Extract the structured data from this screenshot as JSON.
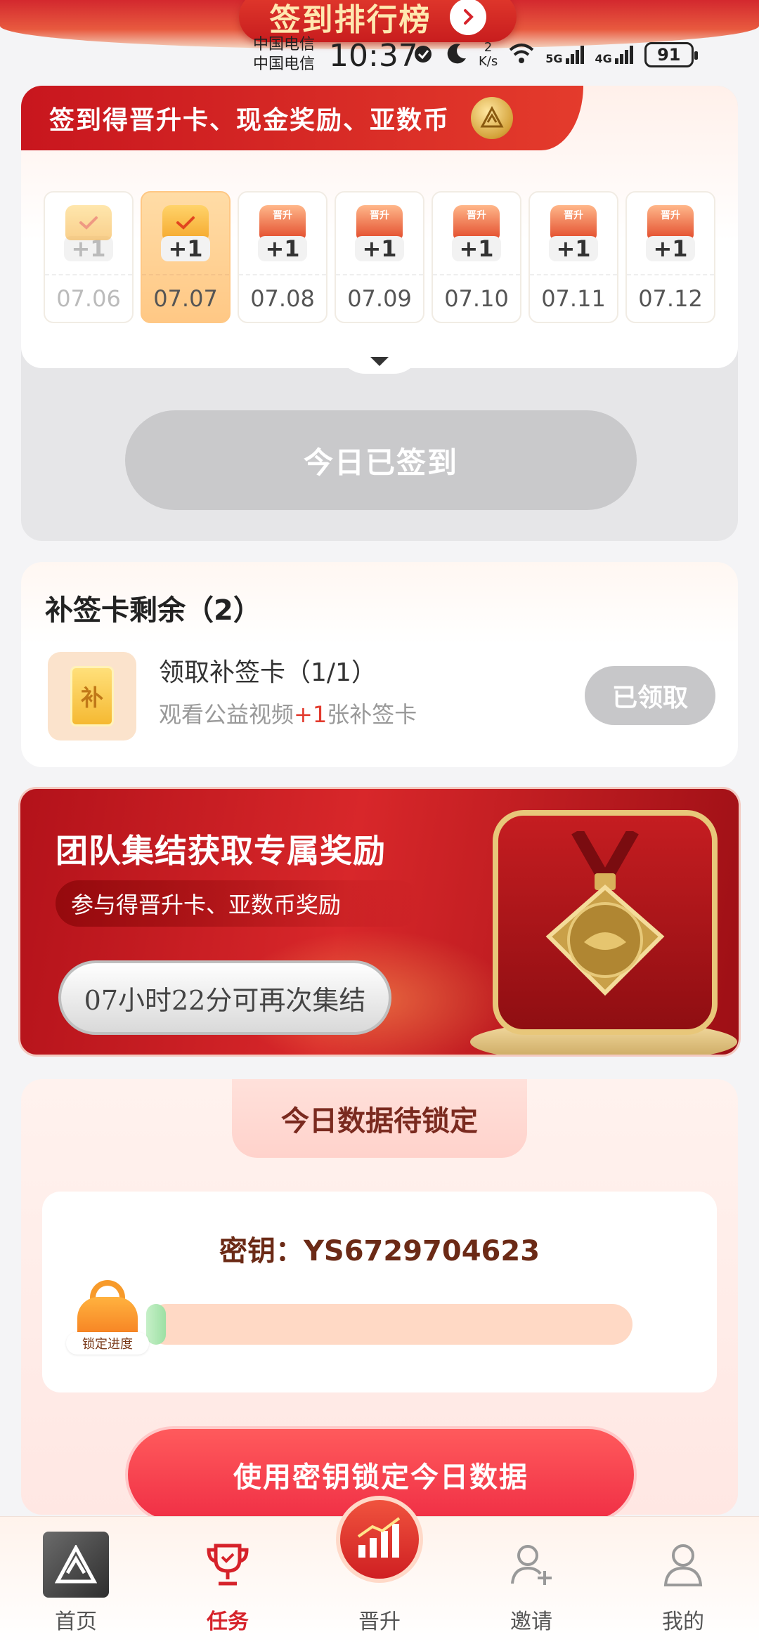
{
  "top_banner": {
    "rank_label": "签到排行榜"
  },
  "status_bar": {
    "carrier_1": "中国电信",
    "carrier_2": "中国电信",
    "time": "10:37",
    "net_speed_value": "2",
    "net_speed_unit": "K/s",
    "signal_1": "5G",
    "signal_2": "4G",
    "battery": "91"
  },
  "checkin": {
    "header_title": "签到得晋升卡、现金奖励、亚数币",
    "days": [
      {
        "date": "07.06",
        "reward": "+1",
        "type": "checked",
        "state": "past"
      },
      {
        "date": "07.07",
        "reward": "+1",
        "type": "checked",
        "state": "today"
      },
      {
        "date": "07.08",
        "reward": "+1",
        "type": "promo",
        "promo_text": "晋升",
        "state": "future"
      },
      {
        "date": "07.09",
        "reward": "+1",
        "type": "promo",
        "promo_text": "晋升",
        "state": "future"
      },
      {
        "date": "07.10",
        "reward": "+1",
        "type": "promo",
        "promo_text": "晋升",
        "state": "future"
      },
      {
        "date": "07.11",
        "reward": "+1",
        "type": "promo",
        "promo_text": "晋升",
        "state": "future"
      },
      {
        "date": "07.12",
        "reward": "+1",
        "type": "promo",
        "promo_text": "晋升",
        "state": "future"
      }
    ],
    "button_label": "今日已签到"
  },
  "makeup": {
    "title": "补签卡剩余（2）",
    "icon_char": "补",
    "task_name": "领取补签卡（1/1）",
    "desc_prefix": "观看公益视频",
    "desc_highlight": "+1",
    "desc_suffix": "张补签卡",
    "button_label": "已领取"
  },
  "team": {
    "title": "团队集结获取专属奖励",
    "subtitle": "参与得晋升卡、亚数币奖励",
    "countdown_label": "07小时22分可再次集结"
  },
  "lock": {
    "header": "今日数据待锁定",
    "key_label": "密钥：YS6729704623",
    "progress_label": "锁定进度",
    "progress_fraction": 0.04,
    "button_label": "使用密钥锁定今日数据"
  },
  "nav": {
    "items": [
      {
        "label": "首页",
        "icon": "home-logo-icon",
        "active": false
      },
      {
        "label": "任务",
        "icon": "trophy-icon",
        "active": true
      },
      {
        "label": "晋升",
        "icon": "promotion-chart-icon",
        "active": false
      },
      {
        "label": "邀请",
        "icon": "invite-user-icon",
        "active": false
      },
      {
        "label": "我的",
        "icon": "profile-icon",
        "active": false
      }
    ]
  },
  "colors": {
    "primary_red": "#d6222a",
    "gold": "#e8c77a",
    "grey_disabled": "#c9c9cb"
  }
}
